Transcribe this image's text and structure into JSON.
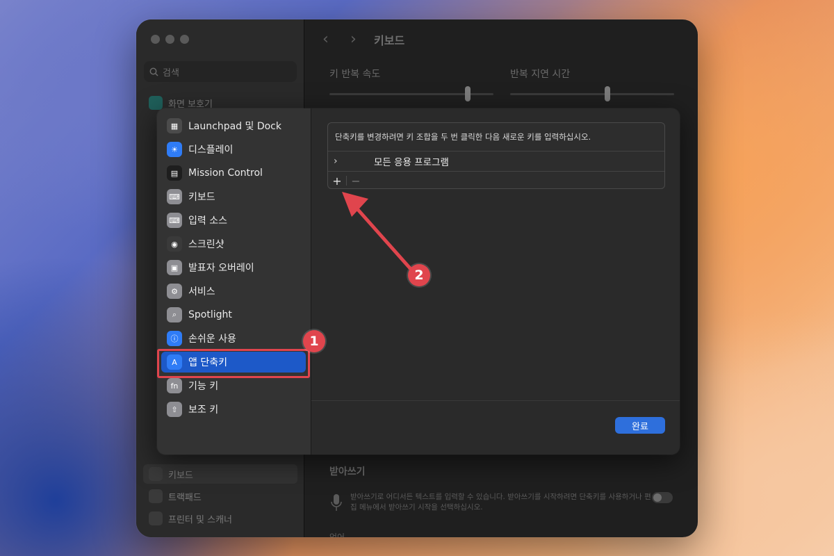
{
  "window": {
    "title": "키보드",
    "sidebar_search_placeholder": "검색",
    "sidebar_items": [
      "화면 보호기",
      "키보드",
      "트랙패드",
      "프린터 및 스캐너"
    ],
    "slider_repeat_label": "키 반복 속도",
    "slider_delay_label": "반복 지연 시간",
    "dictation_heading": "받아쓰기",
    "dictation_text": "받아쓰기로 어디서든 텍스트를 입력할 수 있습니다. 받아쓰기를 시작하려면 단축키를 사용하거나 편집 메뉴에서 받아쓰기 시작을 선택하십시오.",
    "bottom_row_label": "언어"
  },
  "dialog": {
    "sidebar_items": [
      {
        "label": "Launchpad 및 Dock",
        "icon": "launchpad-icon",
        "color": "#4b4b4b"
      },
      {
        "label": "디스플레이",
        "icon": "display-icon",
        "color": "#2f7cf6"
      },
      {
        "label": "Mission Control",
        "icon": "mission-control-icon",
        "color": "#1e1e1e"
      },
      {
        "label": "키보드",
        "icon": "keyboard-icon",
        "color": "#8e8e93"
      },
      {
        "label": "입력 소스",
        "icon": "input-source-icon",
        "color": "#8e8e93"
      },
      {
        "label": "스크린샷",
        "icon": "screenshot-icon",
        "color": "#3a3a3a"
      },
      {
        "label": "발표자 오버레이",
        "icon": "presenter-overlay-icon",
        "color": "#8e8e93"
      },
      {
        "label": "서비스",
        "icon": "services-icon",
        "color": "#8e8e93"
      },
      {
        "label": "Spotlight",
        "icon": "spotlight-icon",
        "color": "#8e8e93"
      },
      {
        "label": "손쉬운 사용",
        "icon": "accessibility-icon",
        "color": "#2f7cf6"
      },
      {
        "label": "앱 단축키",
        "icon": "app-shortcuts-icon",
        "color": "#2f7cf6"
      },
      {
        "label": "기능 키",
        "icon": "function-key-icon",
        "color": "#8e8e93"
      },
      {
        "label": "보조 키",
        "icon": "modifier-key-icon",
        "color": "#8e8e93"
      }
    ],
    "selected_index": 10,
    "description": "단축키를 변경하려면 키 조합을 두 번 클릭한 다음 새로운 키를 입력하십시오.",
    "row_label": "모든 응용 프로그램",
    "add_label": "+",
    "remove_label": "−",
    "done_label": "완료"
  },
  "annotations": {
    "badge_1": "1",
    "badge_2": "2",
    "color": "#e0454d"
  }
}
